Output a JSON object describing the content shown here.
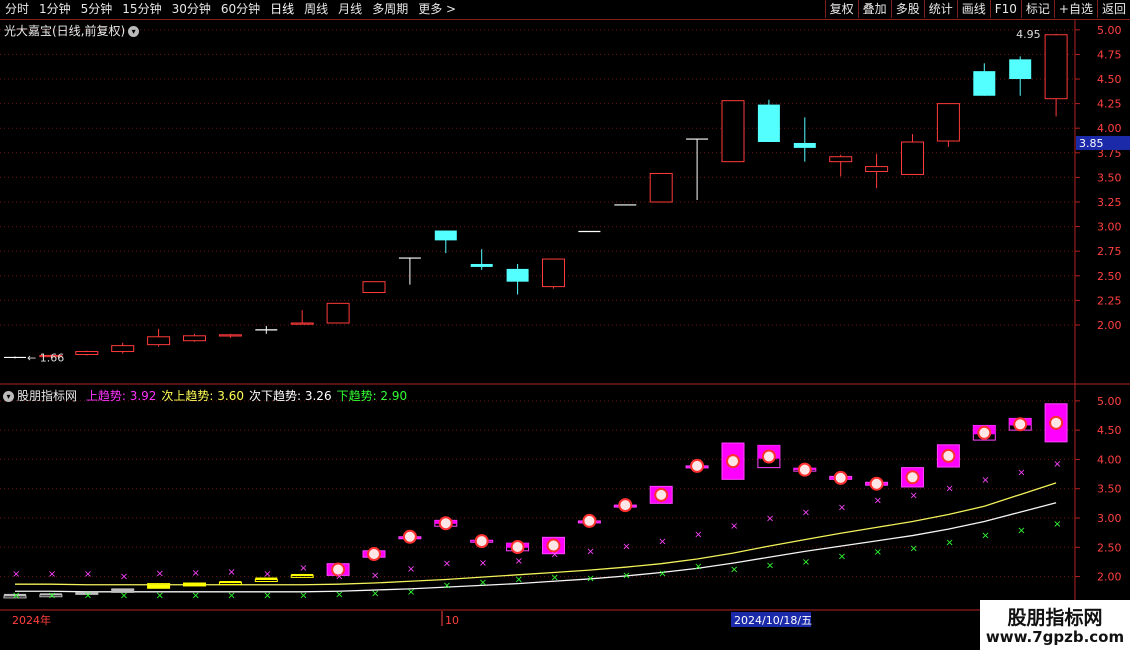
{
  "toolbar": {
    "left": [
      {
        "label": "分时",
        "name": "tab-intraday"
      },
      {
        "label": "1分钟",
        "name": "tab-1min"
      },
      {
        "label": "5分钟",
        "name": "tab-5min"
      },
      {
        "label": "15分钟",
        "name": "tab-15min"
      },
      {
        "label": "30分钟",
        "name": "tab-30min"
      },
      {
        "label": "60分钟",
        "name": "tab-60min"
      },
      {
        "label": "日线",
        "name": "tab-daily"
      },
      {
        "label": "周线",
        "name": "tab-weekly"
      },
      {
        "label": "月线",
        "name": "tab-monthly"
      },
      {
        "label": "多周期",
        "name": "tab-multi-period"
      },
      {
        "label": "更多 >",
        "name": "tab-more"
      }
    ],
    "right": [
      {
        "label": "复权",
        "name": "restore-rights-button"
      },
      {
        "label": "叠加",
        "name": "overlay-button"
      },
      {
        "label": "多股",
        "name": "multi-stock-button"
      },
      {
        "label": "统计",
        "name": "statistics-button"
      },
      {
        "label": "画线",
        "name": "draw-line-button"
      },
      {
        "label": "F10",
        "name": "f10-button"
      },
      {
        "label": "标记",
        "name": "mark-button"
      },
      {
        "label": "+自选",
        "name": "add-watchlist-button"
      },
      {
        "label": "返回",
        "name": "back-button"
      }
    ]
  },
  "main": {
    "title": "光大嘉宝(日线,前复权)",
    "current_price": "3.85",
    "max_label": "4.95",
    "min_label": "1.66",
    "axis_labels": [
      "5.00",
      "4.75",
      "4.50",
      "4.25",
      "4.00",
      "3.75",
      "3.50",
      "3.25",
      "3.00",
      "2.75",
      "2.50",
      "2.25",
      "2.00"
    ]
  },
  "indicator": {
    "name": "股朋指标网",
    "items": [
      {
        "label": "上趋势: 3.92",
        "color": "#ff33ff"
      },
      {
        "label": "次上趋势: 3.60",
        "color": "#ffff55"
      },
      {
        "label": "次下趋势: 3.26",
        "color": "#ffffff"
      },
      {
        "label": "下趋势: 2.90",
        "color": "#33ff33"
      }
    ],
    "axis_labels": [
      "5.00",
      "4.50",
      "4.00",
      "3.50",
      "3.00",
      "2.50",
      "2.00"
    ]
  },
  "date_axis": {
    "year_label": "2024年",
    "month_label": "10",
    "cursor_label": "2024/10/18/五"
  },
  "watermark": {
    "line1": "股朋指标网",
    "line2": "www.7gpzb.com"
  },
  "colors": {
    "up": "#ff3b3b",
    "down": "#54ffff",
    "frame": "#b22222",
    "grid": "#6a1515"
  },
  "chart_data": {
    "type": "candlestick",
    "candles": [
      {
        "o": 1.67,
        "c": 1.67,
        "h": 1.68,
        "l": 1.66
      },
      {
        "o": 1.68,
        "c": 1.69,
        "h": 1.7,
        "l": 1.67
      },
      {
        "o": 1.7,
        "c": 1.73,
        "h": 1.74,
        "l": 1.69
      },
      {
        "o": 1.73,
        "c": 1.79,
        "h": 1.82,
        "l": 1.71
      },
      {
        "o": 1.8,
        "c": 1.88,
        "h": 1.96,
        "l": 1.78
      },
      {
        "o": 1.84,
        "c": 1.89,
        "h": 1.91,
        "l": 1.83
      },
      {
        "o": 1.89,
        "c": 1.9,
        "h": 1.91,
        "l": 1.87
      },
      {
        "o": 1.95,
        "c": 1.95,
        "h": 1.99,
        "l": 1.91
      },
      {
        "o": 2.01,
        "c": 2.02,
        "h": 2.15,
        "l": 2.01
      },
      {
        "o": 2.02,
        "c": 2.22,
        "h": 2.22,
        "l": 2.02
      },
      {
        "o": 2.33,
        "c": 2.44,
        "h": 2.44,
        "l": 2.33
      },
      {
        "o": 2.68,
        "c": 2.68,
        "h": 2.68,
        "l": 2.41
      },
      {
        "o": 2.96,
        "c": 2.86,
        "h": 2.96,
        "l": 2.73
      },
      {
        "o": 2.62,
        "c": 2.59,
        "h": 2.77,
        "l": 2.56
      },
      {
        "o": 2.57,
        "c": 2.44,
        "h": 2.62,
        "l": 2.31
      },
      {
        "o": 2.39,
        "c": 2.67,
        "h": 2.67,
        "l": 2.37
      },
      {
        "o": 2.95,
        "c": 2.95,
        "h": 2.95,
        "l": 2.95
      },
      {
        "o": 3.22,
        "c": 3.22,
        "h": 3.22,
        "l": 3.22
      },
      {
        "o": 3.25,
        "c": 3.54,
        "h": 3.54,
        "l": 3.25
      },
      {
        "o": 3.89,
        "c": 3.89,
        "h": 3.89,
        "l": 3.27
      },
      {
        "o": 3.66,
        "c": 4.28,
        "h": 4.28,
        "l": 3.66
      },
      {
        "o": 4.24,
        "c": 3.86,
        "h": 4.29,
        "l": 3.86
      },
      {
        "o": 3.85,
        "c": 3.8,
        "h": 4.11,
        "l": 3.66
      },
      {
        "o": 3.66,
        "c": 3.71,
        "h": 3.73,
        "l": 3.51
      },
      {
        "o": 3.56,
        "c": 3.61,
        "h": 3.74,
        "l": 3.39
      },
      {
        "o": 3.53,
        "c": 3.86,
        "h": 3.94,
        "l": 3.53
      },
      {
        "o": 3.87,
        "c": 4.25,
        "h": 4.25,
        "l": 3.81
      },
      {
        "o": 4.58,
        "c": 4.33,
        "h": 4.66,
        "l": 4.33
      },
      {
        "o": 4.7,
        "c": 4.5,
        "h": 4.73,
        "l": 4.33
      },
      {
        "o": 4.3,
        "c": 4.95,
        "h": 4.96,
        "l": 4.12
      }
    ],
    "main_range": [
      1.4,
      5.1
    ],
    "indicator_range": [
      1.6,
      5.1
    ],
    "indicator_lines": {
      "upper_trend_marks": [
        2.04,
        2.04,
        2.04,
        2.0,
        2.05,
        2.06,
        2.08,
        2.04,
        2.15,
        2.0,
        2.02,
        2.13,
        2.22,
        2.23,
        2.27,
        2.38,
        2.43,
        2.51,
        2.6,
        2.72,
        2.86,
        2.99,
        3.09,
        3.18,
        3.3,
        3.38,
        3.5,
        3.65,
        3.78,
        3.92
      ],
      "second_upper_trend": [
        1.87,
        1.87,
        1.86,
        1.86,
        1.86,
        1.86,
        1.86,
        1.86,
        1.86,
        1.87,
        1.89,
        1.92,
        1.95,
        1.99,
        2.03,
        2.07,
        2.11,
        2.16,
        2.22,
        2.3,
        2.4,
        2.52,
        2.63,
        2.74,
        2.84,
        2.94,
        3.06,
        3.2,
        3.4,
        3.6
      ],
      "second_lower_trend": [
        1.75,
        1.75,
        1.74,
        1.74,
        1.74,
        1.74,
        1.74,
        1.74,
        1.74,
        1.75,
        1.77,
        1.79,
        1.82,
        1.85,
        1.88,
        1.92,
        1.96,
        2.01,
        2.07,
        2.14,
        2.23,
        2.33,
        2.43,
        2.52,
        2.61,
        2.7,
        2.81,
        2.94,
        3.1,
        3.26
      ],
      "lower_trend_marks": [
        1.68,
        1.68,
        1.68,
        1.68,
        1.68,
        1.68,
        1.68,
        1.68,
        1.68,
        1.69,
        1.71,
        1.74,
        1.85,
        1.9,
        1.95,
        1.98,
        1.97,
        2.02,
        2.05,
        2.17,
        2.12,
        2.19,
        2.25,
        2.34,
        2.42,
        2.48,
        2.58,
        2.7,
        2.79,
        2.9
      ]
    }
  }
}
